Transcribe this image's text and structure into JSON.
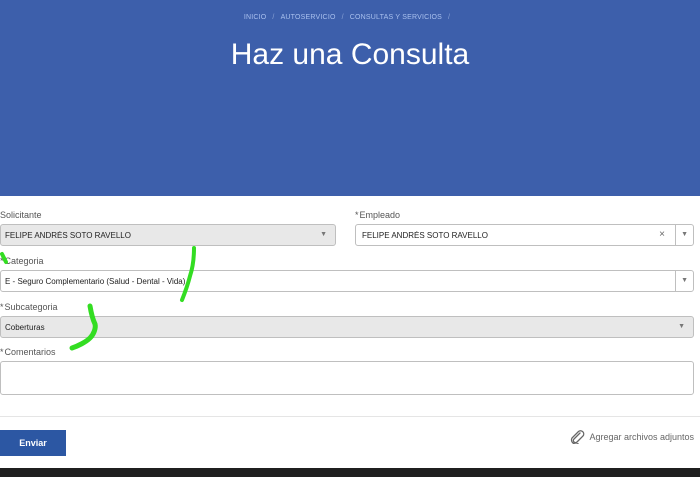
{
  "breadcrumb": [
    "INICIO",
    "AUTOSERVICIO",
    "CONSULTAS Y SERVICIOS"
  ],
  "breadcrumb_separator": "/",
  "title": "Haz una Consulta",
  "form": {
    "required_mark": "*",
    "solicitante": {
      "label": "Solicitante",
      "value": "FELIPE ANDRÉS SOTO RAVELLO"
    },
    "empleado": {
      "label": "Empleado",
      "value": "FELIPE ANDRÉS SOTO RAVELLO"
    },
    "categoria": {
      "label": "Categoria",
      "value": "E - Seguro Complementario (Salud - Dental - Vida)"
    },
    "subcategoria": {
      "label": "Subcategoria",
      "value": "Coberturas"
    },
    "comentarios": {
      "label": "Comentarios",
      "value": ""
    }
  },
  "actions": {
    "send_label": "Enviar",
    "attach_label": "Agregar archivos adjuntos"
  },
  "colors": {
    "hero": "#3d5fab",
    "button": "#2c57a3",
    "annotation": "#33dd22"
  }
}
